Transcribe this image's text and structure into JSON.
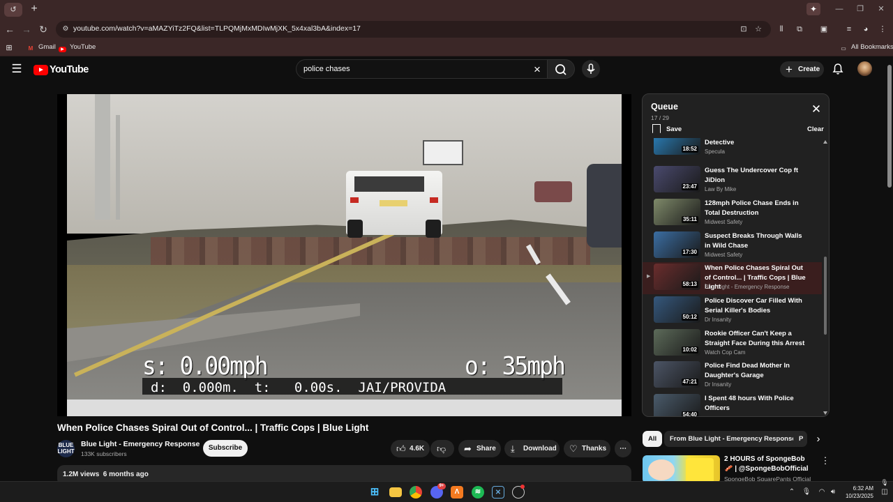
{
  "browser": {
    "tab_icon": "↺",
    "address": "youtube.com/watch?v=aMAZYiTz2FQ&list=TLPQMjMxMDIwMjXK_5x4xal3bA&index=17",
    "bookmarks": [
      {
        "label": "Gmail",
        "icon": "gmail-icon",
        "color": "#ea4335"
      },
      {
        "label": "YouTube",
        "icon": "youtube-icon",
        "color": "#ff0000"
      }
    ],
    "all_bookmarks": "All Bookmarks"
  },
  "youtube": {
    "logo_text": "YouTube",
    "search_value": "police chases",
    "create_label": "Create"
  },
  "video": {
    "hud_speed": "s: 0.00mph",
    "hud_other": "o: 35mph",
    "hud_line": "d:  0.000m.  t:   0.00s.  JAI/PROVIDA",
    "title": "When Police Chases Spiral Out of Control... | Traffic Cops | Blue Light",
    "channel": "Blue Light - Emergency Response",
    "channel_logo": "BLUE LIGHT",
    "subscribers": "133K subscribers",
    "subscribe_label": "Subscribe",
    "likes": "4.6K",
    "share_label": "Share",
    "download_label": "Download",
    "thanks_label": "Thanks",
    "views_date": "1.2M views  6 months ago"
  },
  "queue": {
    "title": "Queue",
    "position": "17 / 29",
    "save_label": "Save",
    "clear_label": "Clear",
    "items": [
      {
        "title": "When Suspects Try To Kill The Detective",
        "channel": "Specula",
        "duration": "18:52",
        "thumb": "#2b86c4"
      },
      {
        "title": "Guess The Undercover Cop ft JiDion",
        "channel": "Law By Mike",
        "duration": "23:47",
        "thumb": "#4a4a6e"
      },
      {
        "title": "128mph Police Chase Ends in Total Destruction",
        "channel": "Midwest Safety",
        "duration": "35:11",
        "thumb": "#7f8a6a"
      },
      {
        "title": "Suspect Breaks Through Walls in Wild Chase",
        "channel": "Midwest Safety",
        "duration": "17:30",
        "thumb": "#3b6ea3"
      },
      {
        "title": "When Police Chases Spiral Out of Control... | Traffic Cops | Blue Light",
        "channel": "Blue Light - Emergency Response",
        "duration": "58:13",
        "thumb": "#6b2d2d",
        "active": true
      },
      {
        "title": "Police Discover Car Filled With Serial Killer's Bodies",
        "channel": "Dr Insanity",
        "duration": "50:12",
        "thumb": "#35587d"
      },
      {
        "title": "Rookie Officer Can't Keep a Straight Face During this Arrest",
        "channel": "Watch Cop Cam",
        "duration": "10:02",
        "thumb": "#5d6b5a"
      },
      {
        "title": "Police Find Dead Mother In Daughter's Garage",
        "channel": "Dr Insanity",
        "duration": "47:21",
        "thumb": "#4c5566"
      },
      {
        "title": "I Spent 48 hours With Police Officers",
        "channel": "",
        "duration": "54:40",
        "thumb": "#4a5b6b"
      }
    ]
  },
  "chips": [
    "All",
    "From Blue Light - Emergency Response",
    "P"
  ],
  "recommended": {
    "title": "2 HOURS of SpongeBob 🥓 | @SpongeBobOfficial",
    "channel": "SpongeBob SquarePants Official"
  },
  "taskbar": {
    "time": "6:32 AM",
    "date": "10/23/2025",
    "discord_badge": "9+"
  }
}
